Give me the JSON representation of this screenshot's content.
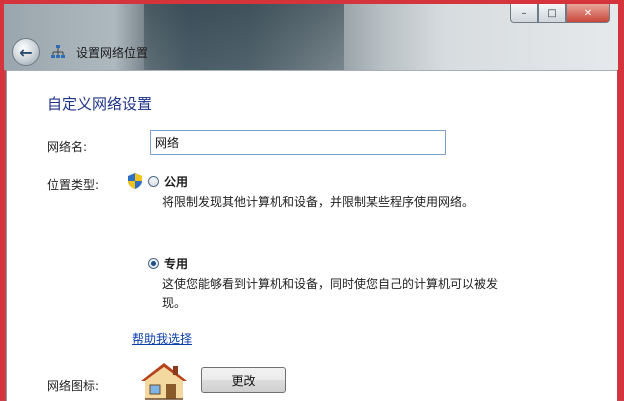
{
  "window": {
    "breadcrumb": "设置网络位置",
    "controls": {
      "minimize": "–",
      "maximize": "□",
      "close": "✕"
    }
  },
  "page": {
    "title": "自定义网络设置",
    "network_name_label": "网络名:",
    "network_name_value": "网络",
    "location_type_label": "位置类型:",
    "options": [
      {
        "label": "公用",
        "description": "将限制发现其他计算机和设备，并限制某些程序使用网络。",
        "selected": false
      },
      {
        "label": "专用",
        "description": "这使您能够看到计算机和设备，同时使您自己的计算机可以被发现。",
        "selected": true
      }
    ],
    "help_link": "帮助我选择",
    "network_icon_label": "网络图标:",
    "change_button": "更改"
  },
  "colors": {
    "title": "#1e3287",
    "link": "#0b3fa8",
    "frame": "#d5343d"
  },
  "icons": [
    "back-arrow-icon",
    "network-icon",
    "uac-shield-icon",
    "house-icon"
  ]
}
